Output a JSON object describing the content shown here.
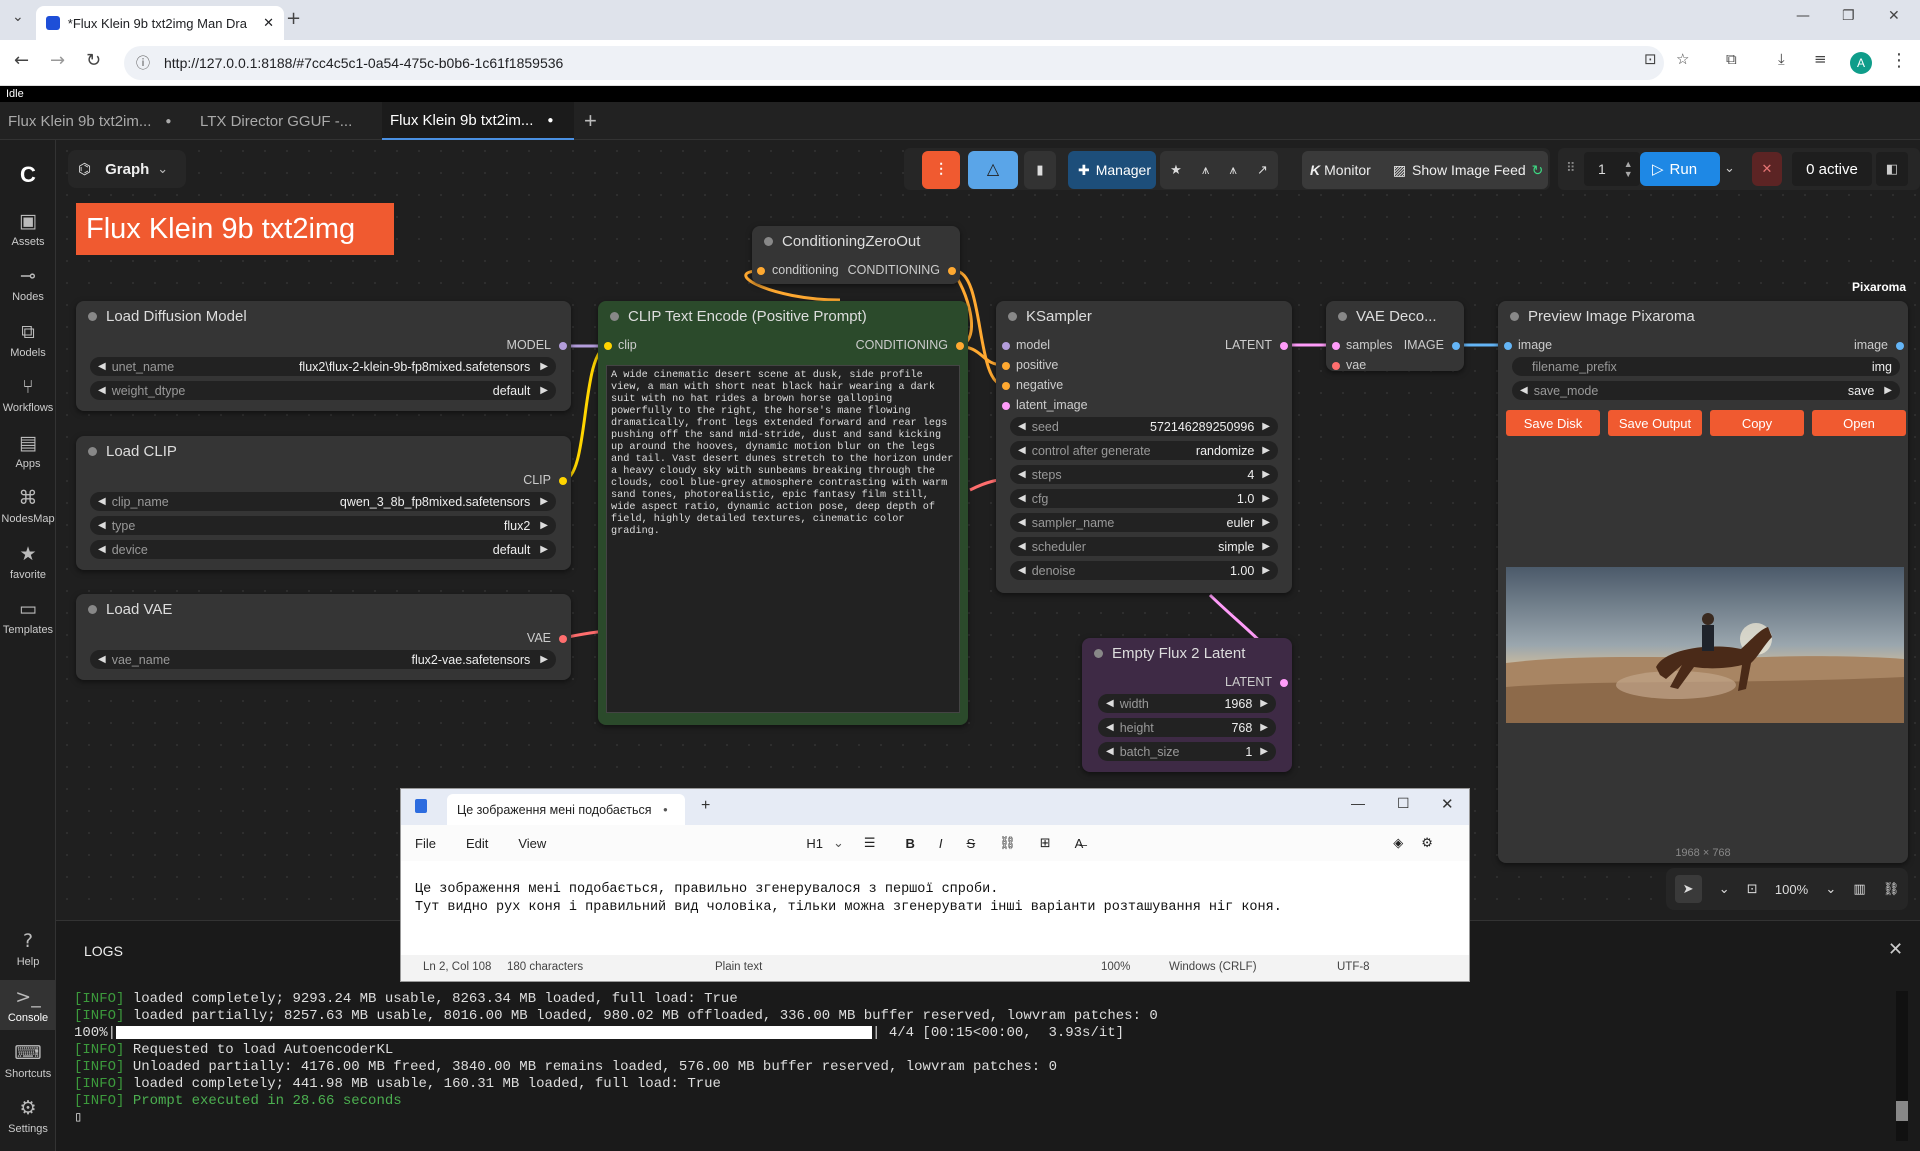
{
  "browser": {
    "tab_title": "*Flux Klein 9b txt2img Man Dra",
    "url": "http://127.0.0.1:8188/#7cc4c5c1-0a54-475c-b0b6-1c61f1859536",
    "profile": "A"
  },
  "status": "Idle",
  "workflow_tabs": [
    "Flux Klein 9b txt2im...",
    "LTX Director GGUF -...",
    "Flux Klein 9b txt2im..."
  ],
  "sidebar": [
    "Assets",
    "Nodes",
    "Models",
    "Workflows",
    "Apps",
    "NodesMap",
    "favorite",
    "Templates",
    "Help",
    "Console",
    "Shortcuts",
    "Settings"
  ],
  "graph_label": "Graph",
  "title_banner": "Flux Klein 9b txt2img",
  "toolbar": {
    "manager": "Manager",
    "monitor": "Monitor",
    "show_feed": "Show Image Feed",
    "queue_count": "1",
    "run": "Run",
    "active": "0 active"
  },
  "pixaroma_label": "Pixaroma",
  "nodes": {
    "load_model": {
      "title": "Load Diffusion Model",
      "out": "MODEL",
      "unet_label": "unet_name",
      "unet": "flux2\\flux-2-klein-9b-fp8mixed.safetensors",
      "dtype_label": "weight_dtype",
      "dtype": "default"
    },
    "load_clip": {
      "title": "Load CLIP",
      "out": "CLIP",
      "name_label": "clip_name",
      "name": "qwen_3_8b_fp8mixed.safetensors",
      "type_label": "type",
      "type": "flux2",
      "device_label": "device",
      "device": "default"
    },
    "load_vae": {
      "title": "Load VAE",
      "out": "VAE",
      "name_label": "vae_name",
      "name": "flux2-vae.safetensors"
    },
    "czo": {
      "title": "ConditioningZeroOut",
      "in": "conditioning",
      "out": "CONDITIONING"
    },
    "clip_text": {
      "title": "CLIP Text Encode (Positive Prompt)",
      "in": "clip",
      "out": "CONDITIONING",
      "prompt": "A wide cinematic desert scene at dusk, side profile view, a man with short neat black hair wearing a dark suit with no hat rides a brown horse galloping powerfully to the right, the horse's mane flowing dramatically, front legs extended forward and rear legs pushing off the sand mid-stride, dust and sand kicking up around the hooves, dynamic motion blur on the legs and tail. Vast desert dunes stretch to the horizon under a heavy cloudy sky with sunbeams breaking through the clouds, cool blue-grey atmosphere contrasting with warm sand tones, photorealistic, epic fantasy film still, wide aspect ratio, dynamic action pose, deep depth of field, highly detailed textures, cinematic color grading."
    },
    "ksampler": {
      "title": "KSampler",
      "out": "LATENT",
      "inputs": [
        "model",
        "positive",
        "negative",
        "latent_image"
      ],
      "widgets": [
        [
          "seed",
          "572146289250996"
        ],
        [
          "control after generate",
          "randomize"
        ],
        [
          "steps",
          "4"
        ],
        [
          "cfg",
          "1.0"
        ],
        [
          "sampler_name",
          "euler"
        ],
        [
          "scheduler",
          "simple"
        ],
        [
          "denoise",
          "1.00"
        ]
      ]
    },
    "vae_decode": {
      "title": "VAE Deco...",
      "in1": "samples",
      "in2": "vae",
      "out": "IMAGE"
    },
    "empty_latent": {
      "title": "Empty Flux 2 Latent",
      "out": "LATENT",
      "widgets": [
        [
          "width",
          "1968"
        ],
        [
          "height",
          "768"
        ],
        [
          "batch_size",
          "1"
        ]
      ]
    },
    "preview": {
      "title": "Preview Image Pixaroma",
      "in": "image",
      "out": "image",
      "prefix_label": "filename_prefix",
      "prefix": "img",
      "mode_label": "save_mode",
      "mode": "save",
      "buttons": [
        "Save Disk",
        "Save Output",
        "Copy",
        "Open"
      ],
      "size": "1968 × 768"
    }
  },
  "canvas_controls": {
    "zoom": "100%"
  },
  "notepad": {
    "tab": "Це зображення мені подобається",
    "menu": [
      "File",
      "Edit",
      "View"
    ],
    "heading": "H1",
    "line1": "Це зображення мені подобається, правильно згенерувалося з першої спроби.",
    "line2": "Тут видно рух коня і правильний вид чоловіка, тільки можна згенерувати інші варіанти розташування ніг коня.",
    "status": [
      "Ln 2, Col 108",
      "180 characters",
      "Plain text",
      "100%",
      "Windows (CRLF)",
      "UTF-8"
    ]
  },
  "logs": {
    "title": "LOGS",
    "lines": [
      [
        "[INFO]",
        " loaded completely; 9293.24 MB usable, 8263.34 MB loaded, full load: True"
      ],
      [
        "[INFO]",
        " loaded partially; 8257.63 MB usable, 8016.00 MB loaded, 980.02 MB offloaded, 336.00 MB buffer reserved, lowvram patches: 0"
      ],
      [
        "",
        "100%|"
      ],
      [
        "[INFO]",
        " Requested to load AutoencoderKL"
      ],
      [
        "[INFO]",
        " Unloaded partially: 4176.00 MB freed, 3840.00 MB remains loaded, 576.00 MB buffer reserved, lowvram patches: 0"
      ],
      [
        "[INFO]",
        " loaded completely; 441.98 MB usable, 160.31 MB loaded, full load: True"
      ],
      [
        "[INFO]",
        " Prompt executed in 28.66 seconds"
      ]
    ],
    "progress_tail": "| 4/4 [00:15<00:00,  3.93s/it]"
  },
  "colors": {
    "accent": "#f05a30",
    "run": "#1e88e5",
    "clip_node": "#2b4a2b",
    "latent_node": "#3e2a45"
  }
}
